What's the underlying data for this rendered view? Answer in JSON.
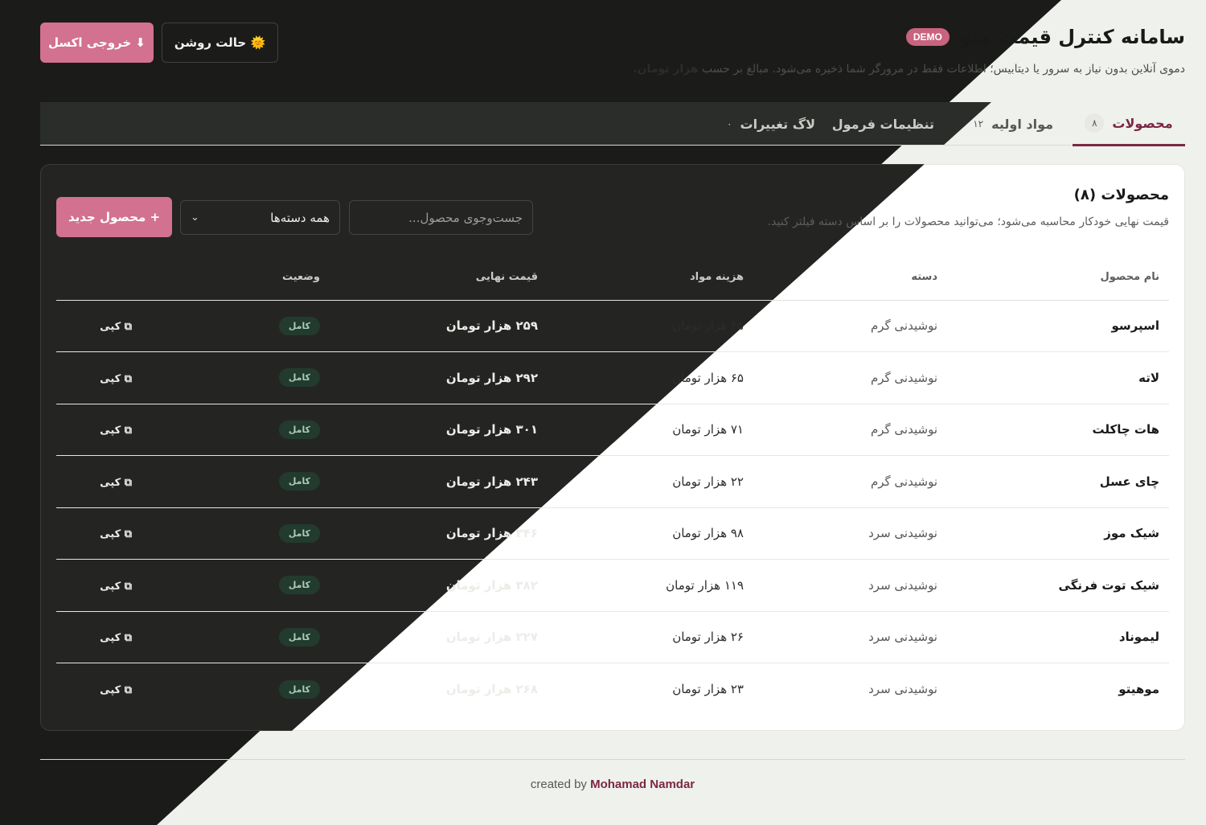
{
  "header": {
    "title": "سامانه کنترل قیمت منو",
    "badge": "DEMO",
    "subtitle_prefix": "دموی آنلاین بدون نیاز به سرور یا دیتابیس؛ اطلاعات فقط در مرورگر شما ذخیره می‌شود. مبالغ بر حسب",
    "subtitle_unit": "هزار تومان.",
    "export_label": "⬇ خروجی اکسل",
    "theme_label": "🌞 حالت روشن"
  },
  "tabs": [
    {
      "label": "محصولات",
      "count": "۸",
      "active": true
    },
    {
      "label": "مواد اولیه",
      "count": "۱۲"
    },
    {
      "label": "تنظیمات فرمول",
      "count": ""
    },
    {
      "label": "لاگ تغییرات",
      "count": "۰"
    }
  ],
  "card": {
    "title": "محصولات (۸)",
    "description": "قیمت نهایی خودکار محاسبه می‌شود؛ می‌توانید محصولات را بر اساس دسته فیلتر کنید.",
    "search_placeholder": "جست‌وجوی محصول...",
    "category_filter": "همه دسته‌ها",
    "new_button": "+ محصول جدید"
  },
  "table": {
    "columns": [
      "نام محصول",
      "دسته",
      "هزینه مواد",
      "قیمت نهایی",
      "وضعیت",
      ""
    ],
    "rows": [
      {
        "name": "اسپرسو",
        "category": "نوشیدنی گرم",
        "cost": "۴۵ هزار تومان",
        "price": "۲۵۹ هزار تومان",
        "status": "کامل",
        "action": "⧉ کپی"
      },
      {
        "name": "لاته",
        "category": "نوشیدنی گرم",
        "cost": "۶۵ هزار تومان",
        "price": "۲۹۲ هزار تومان",
        "status": "کامل",
        "action": "⧉ کپی"
      },
      {
        "name": "هات چاکلت",
        "category": "نوشیدنی گرم",
        "cost": "۷۱ هزار تومان",
        "price": "۳۰۱ هزار تومان",
        "status": "کامل",
        "action": "⧉ کپی"
      },
      {
        "name": "چای عسل",
        "category": "نوشیدنی گرم",
        "cost": "۲۲ هزار تومان",
        "price": "۲۴۳ هزار تومان",
        "status": "کامل",
        "action": "⧉ کپی"
      },
      {
        "name": "شیک موز",
        "category": "نوشیدنی سرد",
        "cost": "۹۸ هزار تومان",
        "price": "۳۴۶ هزار تومان",
        "status": "کامل",
        "action": "⧉ کپی"
      },
      {
        "name": "شیک توت فرنگی",
        "category": "نوشیدنی سرد",
        "cost": "۱۱۹ هزار تومان",
        "price": "۳۸۲ هزار تومان",
        "status": "کامل",
        "action": "⧉ کپی"
      },
      {
        "name": "لیموناد",
        "category": "نوشیدنی سرد",
        "cost": "۲۶ هزار تومان",
        "price": "۲۲۷ هزار تومان",
        "status": "کامل",
        "action": "⧉ کپی"
      },
      {
        "name": "موهیتو",
        "category": "نوشیدنی سرد",
        "cost": "۲۳ هزار تومان",
        "price": "۲۶۸ هزار تومان",
        "status": "کامل",
        "action": "⧉ کپی"
      }
    ]
  },
  "footer": {
    "prefix": "created by",
    "author": "Mohamad Namdar"
  }
}
